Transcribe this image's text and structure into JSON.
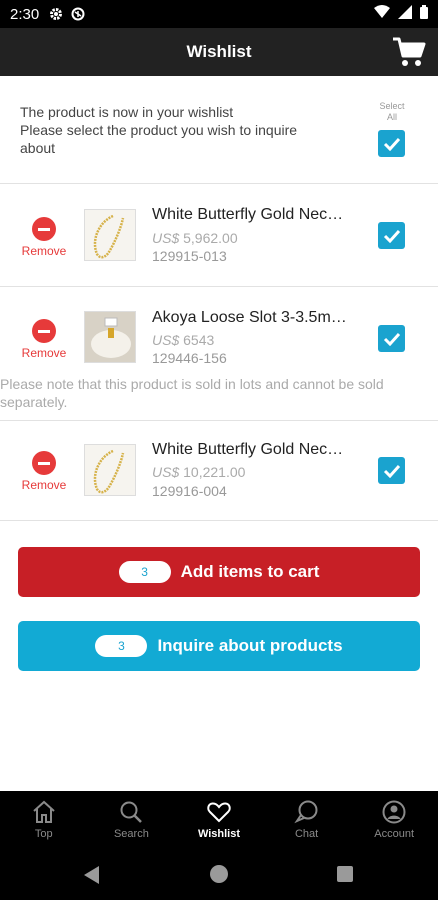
{
  "status_bar": {
    "time": "2:30"
  },
  "header": {
    "title": "Wishlist"
  },
  "notice": {
    "message_lines": [
      "The product is now in your wishlist",
      "Please select the product you wish to inquire",
      "about"
    ],
    "select_all_label_lines": [
      "Select",
      "All"
    ]
  },
  "items": [
    {
      "name": "White Butterfly Gold Nec…",
      "currency": "US$",
      "price": "5,962.00",
      "code": "129915-013",
      "remove_label": "Remove"
    },
    {
      "name": "Akoya Loose Slot 3-3.5m…",
      "currency": "US$",
      "price": "6543",
      "code": "129446-156",
      "remove_label": "Remove",
      "note_lines": [
        "Please note that this product is sold in lots and cannot be sold",
        "separately."
      ]
    },
    {
      "name": "White Butterfly Gold Nec…",
      "currency": "US$",
      "price": "10,221.00",
      "code": "129916-004",
      "remove_label": "Remove"
    }
  ],
  "actions": {
    "cart": {
      "count": "3",
      "label": "Add items to cart"
    },
    "inquire": {
      "count": "3",
      "label": "Inquire about products"
    }
  },
  "nav": [
    {
      "label": "Top",
      "icon": "home-icon"
    },
    {
      "label": "Search",
      "icon": "search-icon"
    },
    {
      "label": "Wishlist",
      "icon": "heart-icon",
      "active": true
    },
    {
      "label": "Chat",
      "icon": "chat-bubble-icon"
    },
    {
      "label": "Account",
      "icon": "account-icon"
    }
  ],
  "colors": {
    "accent_blue": "#12aad4",
    "cart_red": "#c71f26",
    "remove_red": "#e63a3a",
    "header_bg": "#222222"
  }
}
